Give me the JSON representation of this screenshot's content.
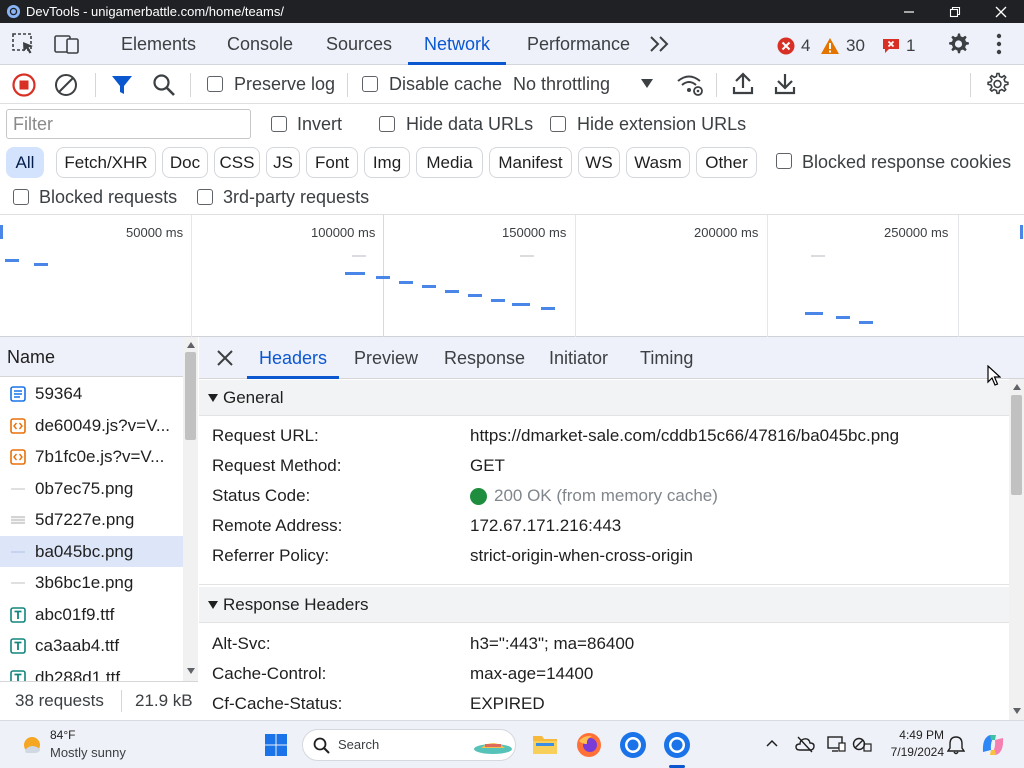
{
  "window": {
    "title": "DevTools - unigamerbattle.com/home/teams/"
  },
  "main_tabs": [
    {
      "label": "Elements"
    },
    {
      "label": "Console"
    },
    {
      "label": "Sources"
    },
    {
      "label": "Network",
      "active": true
    },
    {
      "label": "Performance"
    }
  ],
  "counts": {
    "errors": "4",
    "warnings": "30",
    "issues": "1"
  },
  "toolbar": {
    "preserve_log": "Preserve log",
    "disable_cache": "Disable cache",
    "throttling": "No throttling"
  },
  "filter": {
    "placeholder": "Filter",
    "invert": "Invert",
    "hide_data_urls": "Hide data URLs",
    "hide_extension_urls": "Hide extension URLs"
  },
  "type_filters": [
    "All",
    "Fetch/XHR",
    "Doc",
    "CSS",
    "JS",
    "Font",
    "Img",
    "Media",
    "Manifest",
    "WS",
    "Wasm",
    "Other"
  ],
  "blocked_response_cookies": "Blocked response cookies",
  "blocked_requests": "Blocked requests",
  "third_party_requests": "3rd-party requests",
  "overview": {
    "ticks": [
      "50000 ms",
      "100000 ms",
      "150000 ms",
      "200000 ms",
      "250000 ms"
    ]
  },
  "request_list": {
    "header": "Name",
    "rows": [
      {
        "name": "59364",
        "icon": "document-icon"
      },
      {
        "name": "de60049.js?v=V...",
        "icon": "script-icon"
      },
      {
        "name": "7b1fc0e.js?v=V...",
        "icon": "script-icon"
      },
      {
        "name": "0b7ec75.png",
        "icon": "image-icon"
      },
      {
        "name": "5d7227e.png",
        "icon": "image-icon"
      },
      {
        "name": "ba045bc.png",
        "icon": "image-icon",
        "selected": true
      },
      {
        "name": "3b6bc1e.png",
        "icon": "image-icon"
      },
      {
        "name": "abc01f9.ttf",
        "icon": "font-icon"
      },
      {
        "name": "ca3aab4.ttf",
        "icon": "font-icon"
      },
      {
        "name": "db288d1.ttf",
        "icon": "font-icon"
      }
    ],
    "footer_requests": "38 requests",
    "footer_size": "21.9 kB"
  },
  "details": {
    "tabs": [
      "Headers",
      "Preview",
      "Response",
      "Initiator",
      "Timing"
    ],
    "general": {
      "title": "General",
      "rows": [
        {
          "key": "Request URL:",
          "value": "https://dmarket-sale.com/cddb15c66/47816/ba045bc.png"
        },
        {
          "key": "Request Method:",
          "value": "GET"
        },
        {
          "key": "Status Code:",
          "value": "200 OK (from memory cache)"
        },
        {
          "key": "Remote Address:",
          "value": "172.67.171.216:443"
        },
        {
          "key": "Referrer Policy:",
          "value": "strict-origin-when-cross-origin"
        }
      ]
    },
    "response_headers": {
      "title": "Response Headers",
      "rows": [
        {
          "key": "Alt-Svc:",
          "value": "h3=\":443\"; ma=86400"
        },
        {
          "key": "Cache-Control:",
          "value": "max-age=14400"
        },
        {
          "key": "Cf-Cache-Status:",
          "value": "EXPIRED"
        }
      ]
    }
  },
  "taskbar": {
    "weather_temp": "84°F",
    "weather_desc": "Mostly sunny",
    "search": "Search",
    "time": "4:49 PM",
    "date": "7/19/2024"
  },
  "colors": {
    "accent": "#0b57d0",
    "record": "#d93025",
    "status_ok": "#1e8e3e",
    "error": "#d93025",
    "warning": "#e37400"
  }
}
